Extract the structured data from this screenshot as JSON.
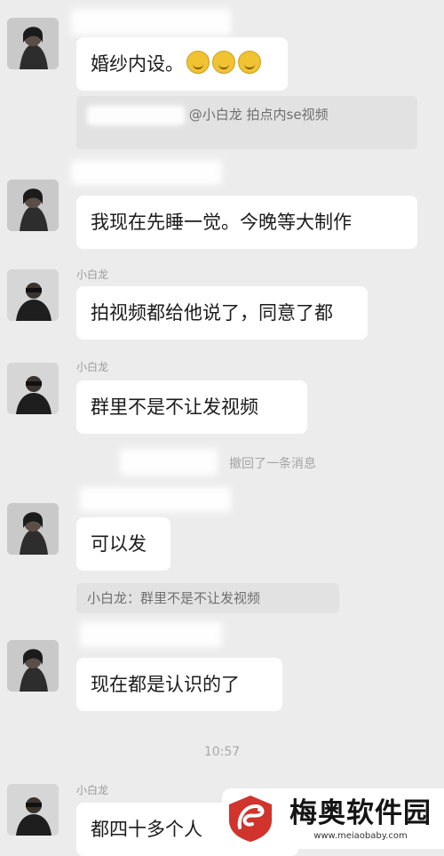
{
  "messages": [
    {
      "text": "婚纱内设。",
      "emoji_count": 3
    },
    {
      "quote": "@小白龙 拍点内se视频"
    },
    {
      "text": "我现在先睡一觉。今晚等大制作"
    },
    {
      "sender": "小白龙",
      "text": "拍视频都给他说了，同意了都"
    },
    {
      "sender": "小白龙",
      "text": "群里不是不让发视频"
    },
    {
      "system": "撤回了一条消息"
    },
    {
      "text": "可以发",
      "quote": "小白龙：群里不是不让发视频"
    },
    {
      "text": "现在都是认识的了"
    },
    {
      "time": "10:57"
    },
    {
      "sender": "小白龙",
      "text": "都四十多个人"
    }
  ],
  "watermark": {
    "title": "梅奥软件园",
    "url": "www.meiaobaby.com",
    "accent": "#d0342c"
  },
  "colors": {
    "background": "#ececec",
    "bubble": "#ffffff"
  }
}
